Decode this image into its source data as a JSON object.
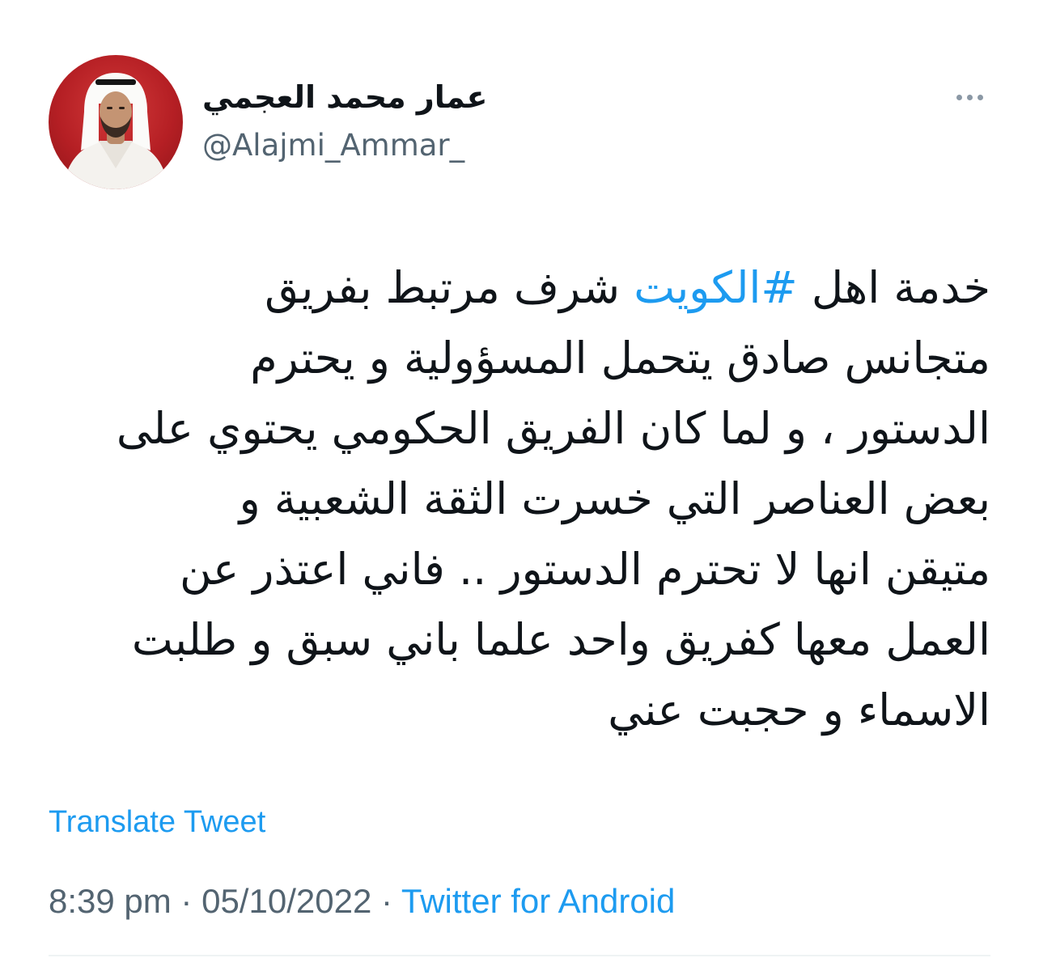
{
  "author": {
    "display_name": "عمار محمد العجمي",
    "handle": "@Alajmi_Ammar_"
  },
  "tweet": {
    "lines": [
      {
        "before": "خدمة اهل ",
        "hashtag": "#الكويت",
        "after": " شرف مرتبط بفريق"
      },
      {
        "text": "متجانس صادق يتحمل المسؤولية و يحترم"
      },
      {
        "text": "الدستور ، و لما كان الفريق الحكومي يحتوي على"
      },
      {
        "text": "بعض العناصر التي خسرت الثقة الشعبية و"
      },
      {
        "text": "متيقن انها لا تحترم الدستور .. فاني اعتذر عن"
      },
      {
        "text": "العمل معها كفريق واحد علما باني سبق و طلبت"
      },
      {
        "text": "الاسماء و حجبت عني"
      }
    ]
  },
  "translate_label": "Translate Tweet",
  "meta": {
    "time": "8:39 pm",
    "separator": " · ",
    "date": "05/10/2022",
    "source": "Twitter for Android"
  },
  "icons": {
    "more": "more-horizontal-icon"
  },
  "colors": {
    "link": "#1d9bf0",
    "secondary_text": "#536471",
    "avatar_background": "#b51f24"
  }
}
